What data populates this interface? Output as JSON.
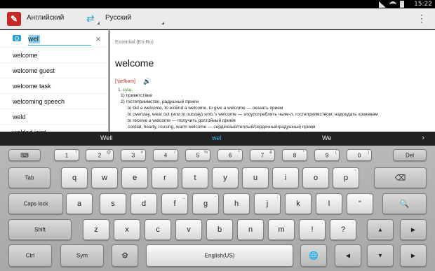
{
  "status": {
    "time": "15:22"
  },
  "app": {
    "logo": "✎",
    "lang_from": "Английский",
    "lang_to": "Русский",
    "swap_icon": "swap-arrows-icon",
    "menu_icon": "overflow-menu-icon"
  },
  "search": {
    "value": "wel",
    "clear_icon": "×"
  },
  "words": [
    "welcome",
    "welcome guest",
    "welcome task",
    "welcoming speech",
    "weld",
    "welded joint"
  ],
  "entry": {
    "dictionary": "Essential (En-Ru)",
    "headword": "welcome",
    "transcription": "['welkəm]",
    "pos": "1. сущ.",
    "defs": [
      "1) приветствие",
      "2) гостеприимство, радушный прием",
      "to bid a welcome, to extend a welcome, to give a welcome — оказать прием",
      "to overstay, wear out (или to outstay) smb.'s welcome — злоупотреблять чьим-л. гостеприимством; надоедать хозяевам",
      "to receive a welcome — получить достойный прием",
      "cordial, hearty, rousing, warm welcome — сердечный/теплый/сердечный/радушный прием"
    ]
  },
  "suggestions": [
    "Well",
    "wel",
    "We"
  ],
  "keyboard": {
    "row1": [
      {
        "label": "",
        "sup": ""
      },
      {
        "label": "1",
        "sup": "!"
      },
      {
        "label": "2",
        "sup": "@"
      },
      {
        "label": "3",
        "sup": "#"
      },
      {
        "label": "4",
        "sup": "/"
      },
      {
        "label": "5",
        "sup": "%"
      },
      {
        "label": "6",
        "sup": "^"
      },
      {
        "label": "7",
        "sup": "&"
      },
      {
        "label": "8",
        "sup": "*"
      },
      {
        "label": "9",
        "sup": "("
      },
      {
        "label": "0",
        "sup": ")"
      },
      {
        "label": "Del",
        "sup": ""
      }
    ],
    "row2": [
      "Tab",
      "q",
      "w",
      "e",
      "r",
      "t",
      "y",
      "u",
      "i",
      "o",
      "p",
      "⌫"
    ],
    "row3": [
      "Caps lock",
      "a",
      "s",
      "d",
      "f",
      "g",
      "h",
      "j",
      "k",
      "l",
      "\"",
      "🔍"
    ],
    "row4": [
      "Shift",
      "z",
      "x",
      "c",
      "v",
      "b",
      "n",
      "m",
      "!",
      "?",
      "▲",
      "▶"
    ],
    "row5": [
      "Ctrl",
      "Sym",
      "⚙",
      "English(US)",
      "🌐",
      "◀",
      "▼",
      "▶"
    ],
    "sups": {
      "e": "",
      "f": "_",
      "g": "-",
      "j": ";",
      "l": ":",
      "p": "~",
      "quote": "'",
      "excl": ",",
      "quest": "."
    }
  }
}
